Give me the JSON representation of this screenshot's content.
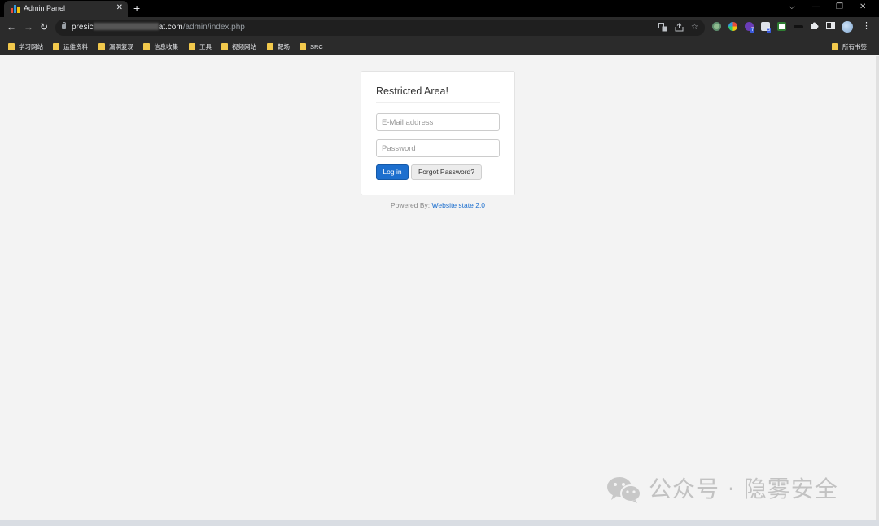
{
  "browser": {
    "tab": {
      "title": "Admin Panel",
      "close": "✕"
    },
    "new_tab": "+",
    "window_controls": {
      "dropdown": "⌵",
      "minimize": "—",
      "restore": "❐",
      "close": "✕"
    },
    "nav": {
      "back": "←",
      "forward": "→",
      "reload": "↻"
    },
    "url": {
      "host_start": "presic",
      "host_end": "at.com",
      "path": "/admin/index.php"
    },
    "extension_badges": [
      "7",
      "5"
    ],
    "bookmarks": [
      "学习网站",
      "运维资料",
      "漏洞复现",
      "信息收集",
      "工具",
      "视频网站",
      "靶场",
      "SRC"
    ],
    "all_bookmarks": "所有书签",
    "colors": {
      "chrome_dark": "#2b2b2b",
      "tabstrip": "#000000",
      "folder": "#f2c94c"
    }
  },
  "login": {
    "title": "Restricted Area!",
    "email_placeholder": "E-Mail address",
    "email_value": "",
    "password_placeholder": "Password",
    "password_value": "",
    "login_button": "Log in",
    "forgot_button": "Forgot Password?",
    "powered_prefix": "Powered By:",
    "powered_link": "Website state 2.0",
    "colors": {
      "primary": "#1d6fce",
      "page_bg": "#f3f3f3"
    }
  },
  "watermark": {
    "text": "公众号 · 隐雾安全"
  }
}
